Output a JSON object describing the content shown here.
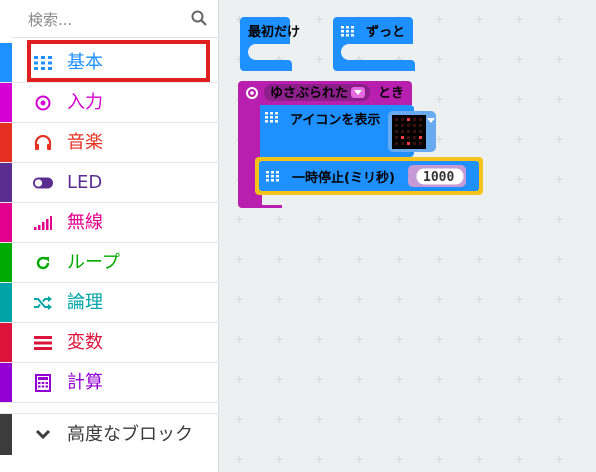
{
  "search": {
    "placeholder": "検索..."
  },
  "toolbox": {
    "categories": [
      {
        "label": "基本",
        "color": "#1e90ff",
        "icon": "grid-icon"
      },
      {
        "label": "入力",
        "color": "#d400d4",
        "icon": "target-icon"
      },
      {
        "label": "音楽",
        "color": "#e63022",
        "icon": "headphones-icon"
      },
      {
        "label": "LED",
        "color": "#5c2d91",
        "icon": "toggle-icon"
      },
      {
        "label": "無線",
        "color": "#e3008c",
        "icon": "signal-bars-icon"
      },
      {
        "label": "ループ",
        "color": "#00aa00",
        "icon": "refresh-icon"
      },
      {
        "label": "論理",
        "color": "#00a4a6",
        "icon": "shuffle-icon"
      },
      {
        "label": "変数",
        "color": "#dc143c",
        "icon": "lines-icon"
      },
      {
        "label": "計算",
        "color": "#9400d3",
        "icon": "calculator-icon"
      }
    ],
    "advanced": {
      "label": "高度なブロック",
      "icon": "chevron-down-icon"
    }
  },
  "workspace": {
    "on_start": {
      "label": "最初だけ",
      "color": "#1e90ff"
    },
    "forever": {
      "label": "ずっと",
      "color": "#1e90ff"
    },
    "on_gesture": {
      "label": "とき",
      "gesture": "ゆさぶられた",
      "color": "#d400d4"
    },
    "show_icon": {
      "label": "アイコンを表示",
      "color": "#1e90ff"
    },
    "pause": {
      "label": "一時停止(ミリ秒)",
      "value": "1000",
      "color": "#1e90ff",
      "highlight": "#f7c21a"
    }
  }
}
